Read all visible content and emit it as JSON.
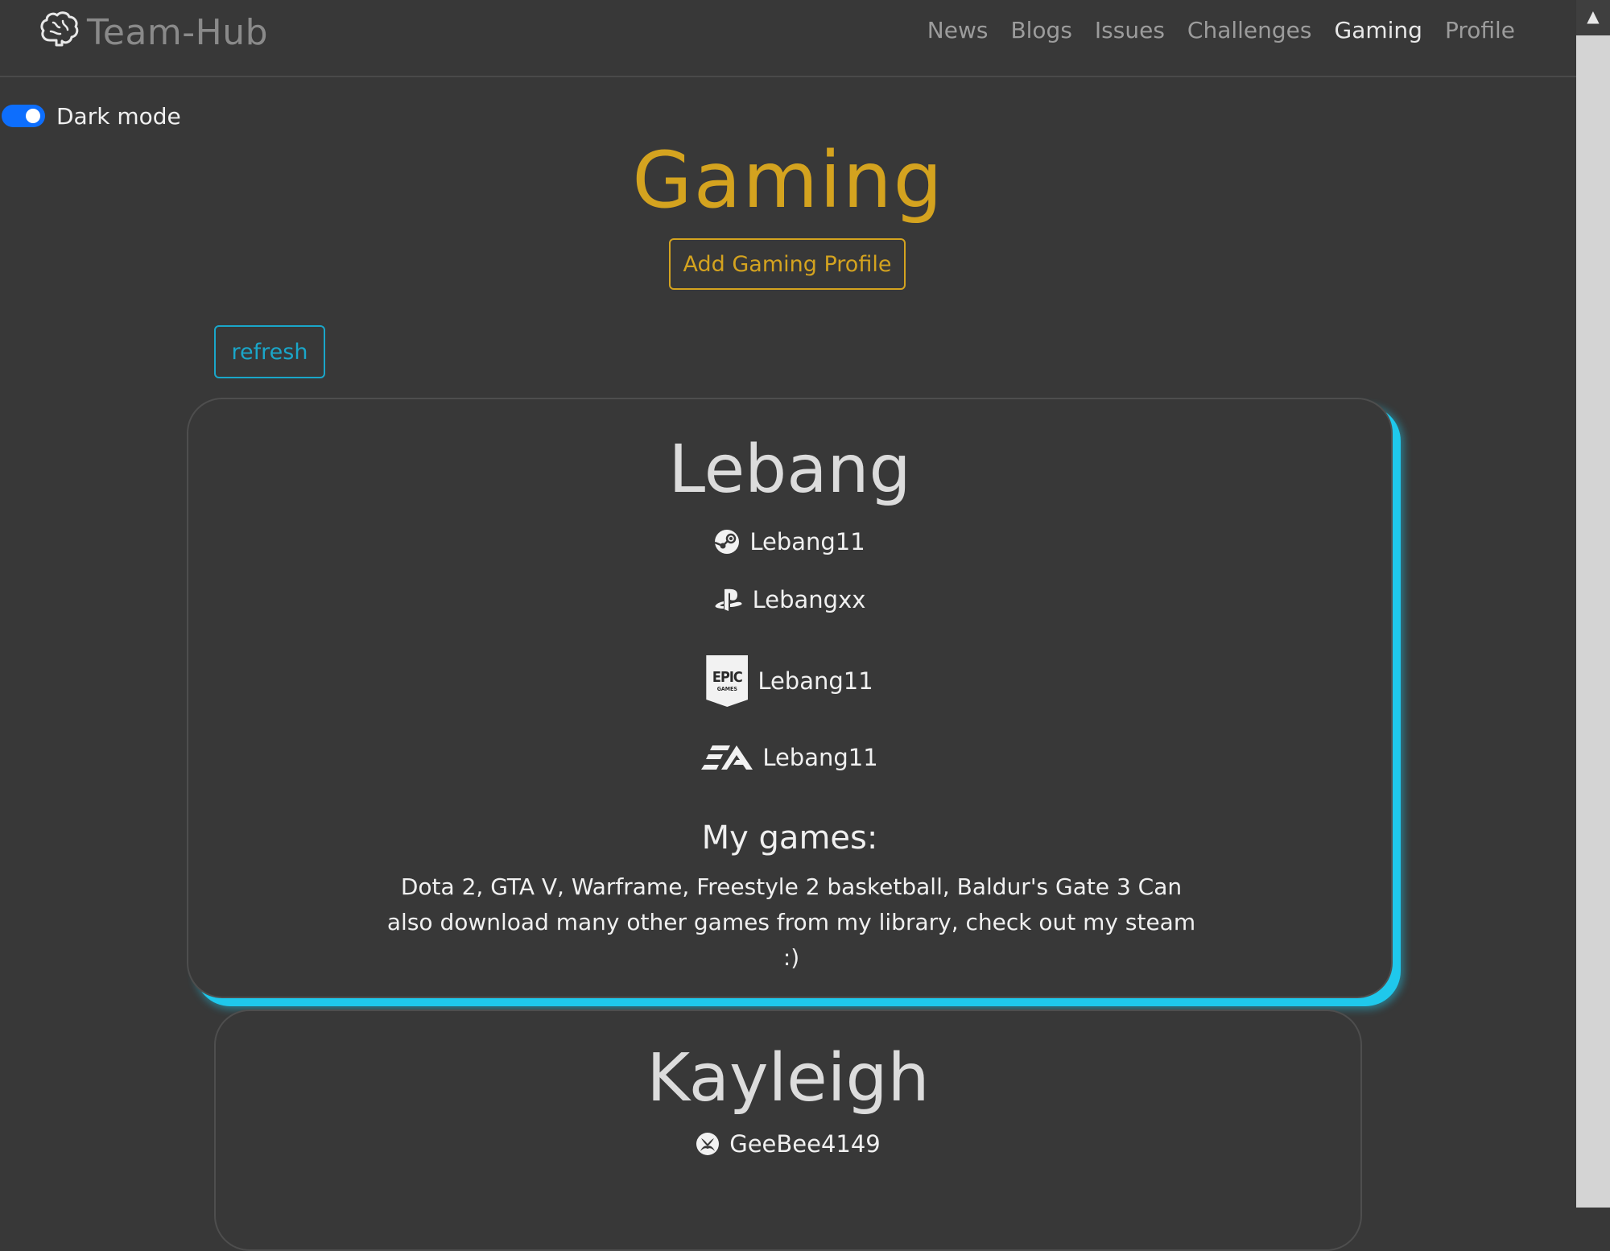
{
  "navbar": {
    "brand": "Team-Hub",
    "links": [
      {
        "label": "News",
        "active": false
      },
      {
        "label": "Blogs",
        "active": false
      },
      {
        "label": "Issues",
        "active": false
      },
      {
        "label": "Challenges",
        "active": false
      },
      {
        "label": "Gaming",
        "active": true
      },
      {
        "label": "Profile",
        "active": false
      }
    ]
  },
  "dark_mode": {
    "label": "Dark mode",
    "enabled": true
  },
  "page": {
    "title": "Gaming",
    "add_button": "Add Gaming Profile",
    "refresh_button": "refresh"
  },
  "profiles": [
    {
      "name": "Lebang",
      "accounts": [
        {
          "platform": "steam-icon",
          "handle": "Lebang11"
        },
        {
          "platform": "playstation-icon",
          "handle": "Lebangxx"
        },
        {
          "platform": "epic-games-icon",
          "handle": "Lebang11"
        },
        {
          "platform": "ea-icon",
          "handle": "Lebang11"
        }
      ],
      "games_heading": "My games:",
      "games": "Dota 2, GTA V, Warframe, Freestyle 2 basketball, Baldur's Gate 3 Can also download many other games from my library, check out my steam :)"
    },
    {
      "name": "Kayleigh",
      "accounts": [
        {
          "platform": "xbox-icon",
          "handle": "GeeBee4149"
        }
      ]
    }
  ],
  "colors": {
    "background": "#383838",
    "accent_gold": "#d4a31f",
    "accent_cyan": "#1aa6c9",
    "card_glow": "#1fc8ec",
    "toggle_blue": "#0d6efd"
  }
}
